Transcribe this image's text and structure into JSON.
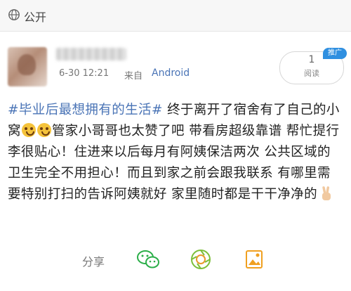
{
  "header": {
    "label": "公开",
    "icon": "globe-icon"
  },
  "user": {
    "avatar": "avatar-blurred",
    "name_blurred": true,
    "timestamp": "6-30 12:21",
    "source_prefix": "来自",
    "source": "Android"
  },
  "read": {
    "count": "1",
    "label": "阅读",
    "badge": "推广"
  },
  "post": {
    "hashtag": "#毕业后最想拥有的生活#",
    "text1": " 终于离开了宿舍有了自己的小窝",
    "text2": "管家小哥哥也太赞了吧 带看房超级靠谱 帮忙提行李很贴心！住进来以后每月有阿姨保洁两次 公共区域的卫生完全不用担心！而且到家之前会跟我联系 有哪里需要特别打扫的告诉阿姨就好 家里随时都是干干净净的"
  },
  "share": {
    "label": "分享",
    "targets": [
      "wechat-icon",
      "moments-icon",
      "image-icon"
    ]
  },
  "colors": {
    "link": "#4a74b6",
    "badge": "#2f8fe0",
    "wechat": "#2aae48",
    "moments": "#7cbf3a",
    "image": "#f0a020"
  }
}
